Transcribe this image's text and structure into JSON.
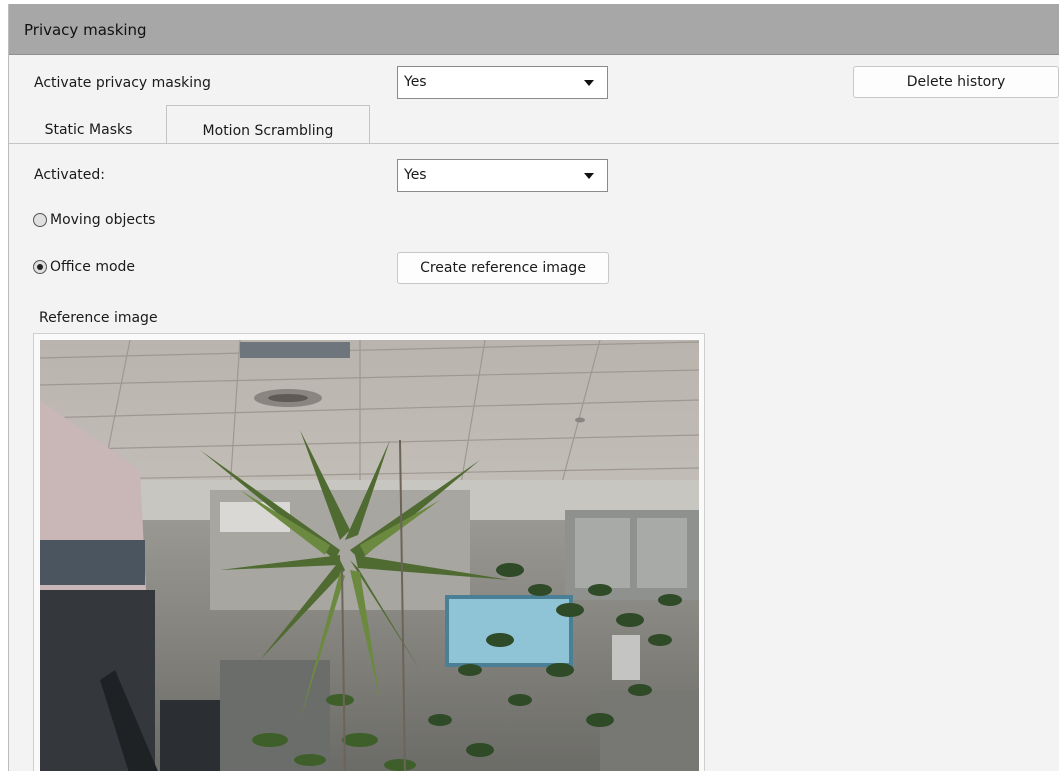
{
  "panel": {
    "title": "Privacy masking"
  },
  "activate": {
    "label": "Activate privacy masking",
    "value": "Yes"
  },
  "delete_history_label": "Delete history",
  "tabs": [
    {
      "label": "Static Masks",
      "active": false
    },
    {
      "label": "Motion Scrambling",
      "active": true
    }
  ],
  "activated": {
    "label": "Activated:",
    "value": "Yes"
  },
  "modes": [
    {
      "label": "Moving objects",
      "checked": false
    },
    {
      "label": "Office mode",
      "checked": true
    }
  ],
  "create_reference_label": "Create reference image",
  "reference_image_label": "Reference image",
  "colors": {
    "titlebar": "#a7a7a7",
    "panel_bg": "#f3f3f3"
  }
}
